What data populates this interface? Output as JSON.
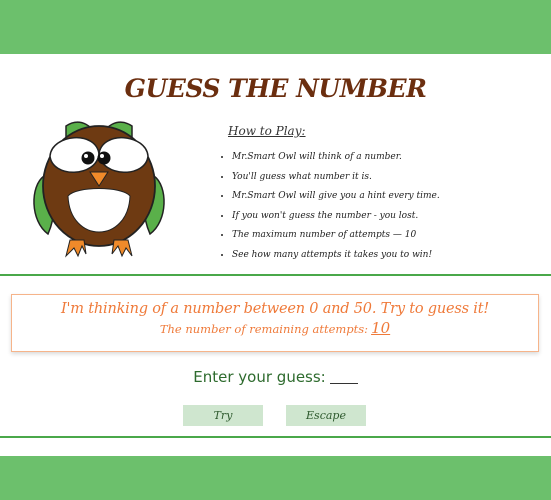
{
  "header": {
    "title": "GUESS THE NUMBER"
  },
  "mascot": {
    "icon": "owl-icon"
  },
  "instructions": {
    "heading": "How to Play:",
    "items": [
      "Mr.Smart Owl will think of a number.",
      "You'll guess what number it is.",
      "Mr.Smart Owl will give you a hint every time.",
      "If you won't guess the number - you lost.",
      "The maximum number of attempts — 10",
      "See how many attempts it takes you to win!"
    ]
  },
  "message": {
    "main": "I'm thinking of a number between 0 and 50. Try to guess it!",
    "remaining_label": "The number of remaining attempts:",
    "remaining_count": "10"
  },
  "guess": {
    "label": "Enter your guess:"
  },
  "buttons": {
    "try": "Try",
    "escape": "Escape"
  },
  "colors": {
    "band": "#6cc06c",
    "title": "#6b2e0f",
    "accent": "#ef7a3a",
    "button_bg": "#cfe6cf"
  }
}
